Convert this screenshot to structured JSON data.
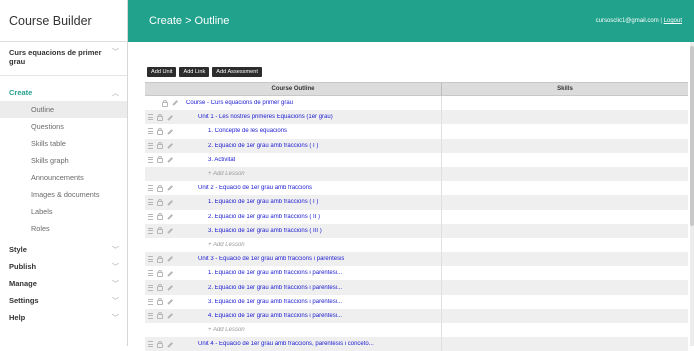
{
  "app": {
    "title": "Course Builder"
  },
  "sidebar": {
    "course_name": "Curs equacions de primer grau",
    "create": {
      "label": "Create",
      "items": [
        "Outline",
        "Questions",
        "Skills table",
        "Skills graph",
        "Announcements",
        "Images & documents",
        "Labels",
        "Roles"
      ]
    },
    "sections": [
      "Style",
      "Publish",
      "Manage",
      "Settings",
      "Help"
    ]
  },
  "header": {
    "breadcrumb": "Create > Outline",
    "user_email": "cursosclic1@gmail.com",
    "separator": "|",
    "logout": "Logout"
  },
  "toolbar": {
    "add_unit": "Add Unit",
    "add_link": "Add Link",
    "add_assessment": "Add Assessment"
  },
  "table": {
    "col_outline": "Course Outline",
    "col_skills": "Skills",
    "course_row": "Course - Curs equacions de primer grau",
    "rows": [
      {
        "text": "Unit 1 - Les nostres primeres Equacions (1er grau)",
        "kind": "unit"
      },
      {
        "text": "1. Concepte de les equacions",
        "kind": "lesson"
      },
      {
        "text": "2. Equació de 1er grau amb fraccions ( I )",
        "kind": "lesson"
      },
      {
        "text": "3. Activitat",
        "kind": "lesson"
      },
      {
        "text": "+ Add Lesson",
        "kind": "add"
      },
      {
        "text": "Unit 2 - Equació de 1er grau amb fraccions",
        "kind": "unit"
      },
      {
        "text": "1. Equació de 1er grau amb fraccions ( I )",
        "kind": "lesson"
      },
      {
        "text": "2. Equació de 1er grau amb fraccions ( II )",
        "kind": "lesson"
      },
      {
        "text": "3. Equació de 1er grau amb fraccions ( III )",
        "kind": "lesson"
      },
      {
        "text": "+ Add Lesson",
        "kind": "add"
      },
      {
        "text": "Unit 3 - Equació de 1er grau amb fraccions i parèntesis",
        "kind": "unit"
      },
      {
        "text": "1. Equació de 1er grau amb fraccions i parèntesi...",
        "kind": "lesson"
      },
      {
        "text": "2. Equació de 1er grau amb fraccions i parèntesi...",
        "kind": "lesson"
      },
      {
        "text": "3. Equació de 1er grau amb fraccions i parèntesi...",
        "kind": "lesson"
      },
      {
        "text": "4. Equació de 1er grau amb fraccions i parèntesi...",
        "kind": "lesson"
      },
      {
        "text": "+ Add Lesson",
        "kind": "add"
      },
      {
        "text": "Unit 4 - Equació de 1er grau amb fraccions, parèntesis i conceto...",
        "kind": "unit"
      }
    ]
  },
  "colors": {
    "accent": "#21a28c",
    "link": "#1a1ad2"
  }
}
